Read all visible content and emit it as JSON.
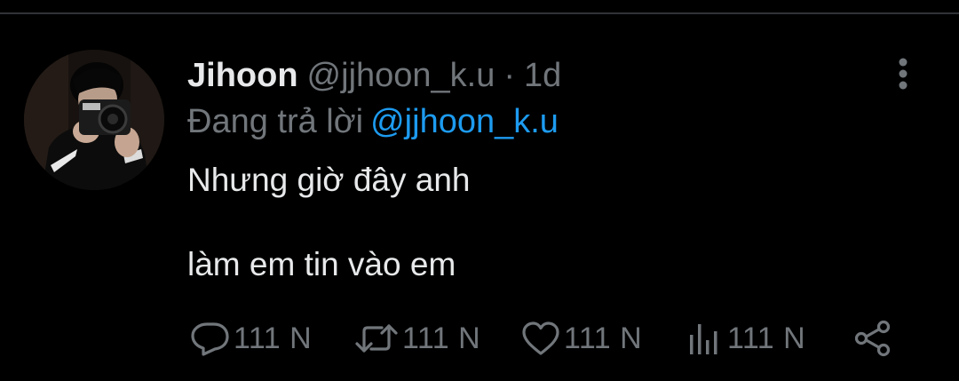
{
  "tweet": {
    "display_name": "Jihoon",
    "handle": "@jjhoon_k.u",
    "separator": "·",
    "time": "1d",
    "reply_prefix": "Đang trả lời",
    "reply_to": "@jjhoon_k.u",
    "text_lines": [
      "Nhưng giờ đây anh",
      "làm em tin vào em"
    ]
  },
  "actions": {
    "replies": "111 N",
    "retweets": "111 N",
    "likes": "111 N",
    "views": "111 N"
  },
  "icons": {
    "more": "vertical-ellipsis-icon",
    "reply": "speech-bubble-icon",
    "retweet": "retweet-icon",
    "like": "heart-icon",
    "views": "bar-chart-icon",
    "share": "share-icon"
  },
  "colors": {
    "background": "#000000",
    "text_primary": "#e7e9ea",
    "text_secondary": "#71767b",
    "link": "#1d9bf0",
    "divider": "#2f3336"
  }
}
